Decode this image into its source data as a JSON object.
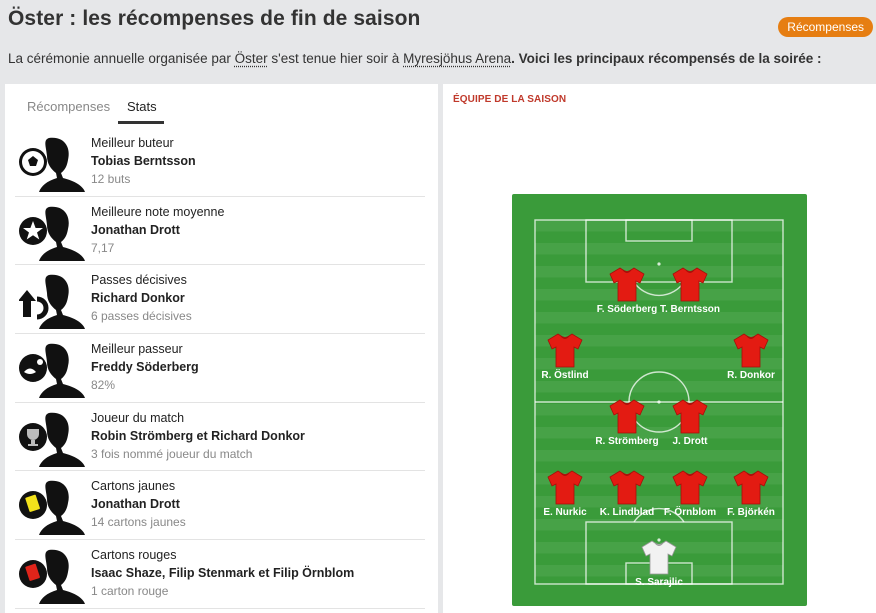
{
  "header": {
    "title": "Öster : les récompenses de fin de saison",
    "badge": "Récompenses",
    "intro_prefix": "La cérémonie annuelle organisée par ",
    "intro_club": "Öster",
    "intro_mid": " s'est tenue hier soir à ",
    "intro_venue": "Myresjöhus Arena",
    "intro_suffix": ". Voici les principaux récompensés de la soirée :"
  },
  "tabs": [
    {
      "label": "Récompenses",
      "active": false
    },
    {
      "label": "Stats",
      "active": true
    }
  ],
  "awards": [
    {
      "category": "Meilleur buteur",
      "player": "Tobias Berntsson",
      "value": "12 buts",
      "icon": "ball-icon"
    },
    {
      "category": "Meilleure note moyenne",
      "player": "Jonathan Drott",
      "value": "7,17",
      "icon": "star-icon"
    },
    {
      "category": "Passes décisives",
      "player": "Richard Donkor",
      "value": "6 passes décisives",
      "icon": "assist-arrow-icon"
    },
    {
      "category": "Meilleur passeur",
      "player": "Freddy Söderberg",
      "value": "82%",
      "icon": "passing-icon"
    },
    {
      "category": "Joueur du match",
      "player": "Robin Strömberg et Richard Donkor",
      "value": "3 fois nommé joueur du match",
      "icon": "trophy-icon"
    },
    {
      "category": "Cartons jaunes",
      "player": "Jonathan Drott",
      "value": "14 cartons jaunes",
      "icon": "yellow-card-icon"
    },
    {
      "category": "Cartons rouges",
      "player": "Isaac Shaze, Filip Stenmark et Filip Örnblom",
      "value": "1 carton rouge",
      "icon": "red-card-icon"
    }
  ],
  "team": {
    "title": "ÉQUIPE DE LA SAISON",
    "players": [
      {
        "name": "F. Söderberg",
        "shirt": "red"
      },
      {
        "name": "T. Berntsson",
        "shirt": "red"
      },
      {
        "name": "R. Östlind",
        "shirt": "red"
      },
      {
        "name": "R. Donkor",
        "shirt": "red"
      },
      {
        "name": "R. Strömberg",
        "shirt": "red"
      },
      {
        "name": "J. Drott",
        "shirt": "red"
      },
      {
        "name": "E. Nurkic",
        "shirt": "red"
      },
      {
        "name": "K. Lindblad",
        "shirt": "red"
      },
      {
        "name": "F. Örnblom",
        "shirt": "red"
      },
      {
        "name": "F. Björkén",
        "shirt": "red"
      },
      {
        "name": "S. Sarajlic",
        "shirt": "white"
      }
    ]
  },
  "colors": {
    "accent": "#e67e12",
    "pitch": "#3a9b3a",
    "shirt_red": "#e31b12",
    "shirt_keeper": "#f2f2f2",
    "section_title": "#c0392b"
  }
}
